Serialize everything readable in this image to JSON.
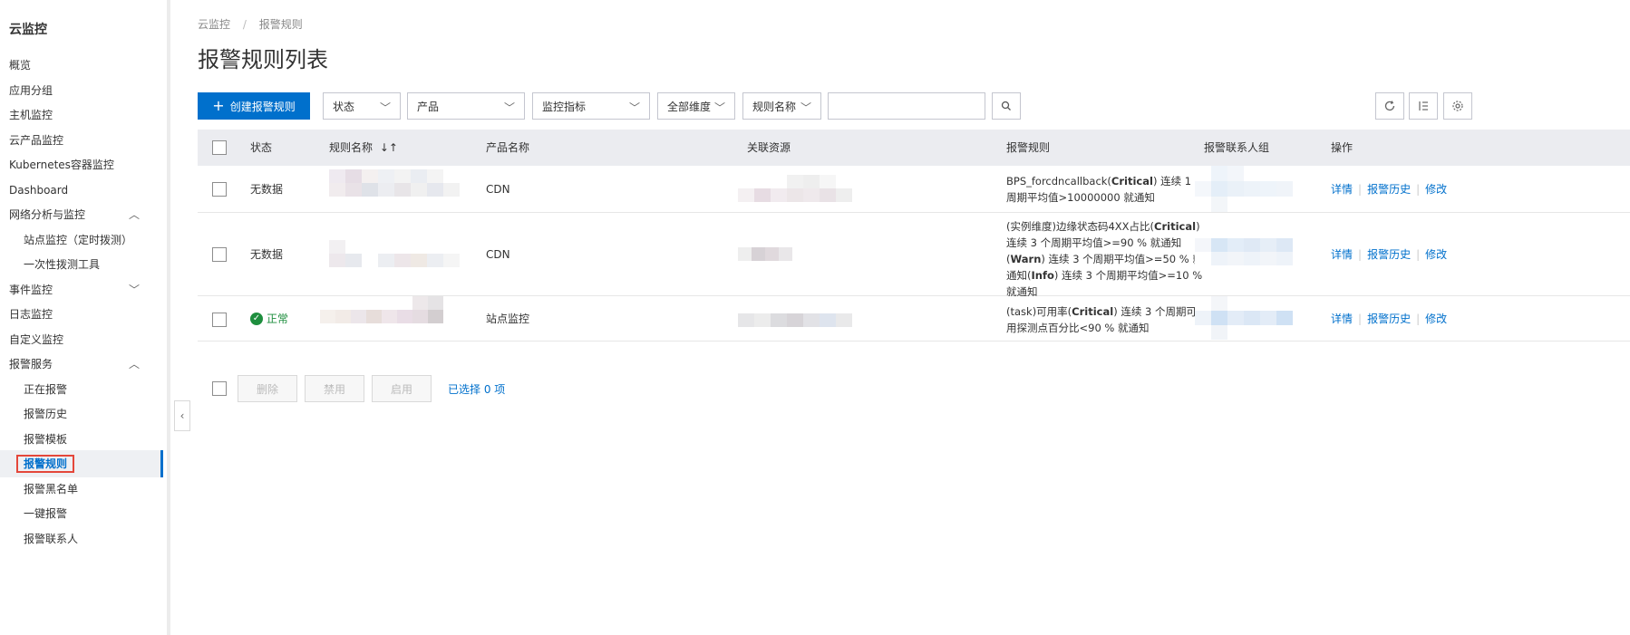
{
  "sidebar": {
    "title": "云监控",
    "items": [
      {
        "label": "概览"
      },
      {
        "label": "应用分组"
      },
      {
        "label": "主机监控"
      },
      {
        "label": "云产品监控"
      },
      {
        "label": "Kubernetes容器监控"
      },
      {
        "label": "Dashboard"
      },
      {
        "label": "网络分析与监控",
        "chevron": "chevron-up-icon"
      },
      {
        "label": "站点监控（定时拨测）"
      },
      {
        "label": "一次性拨测工具"
      },
      {
        "label": "事件监控",
        "chevron": "chevron-down-icon"
      },
      {
        "label": "日志监控"
      },
      {
        "label": "自定义监控"
      },
      {
        "label": "报警服务",
        "chevron": "chevron-up-icon"
      },
      {
        "label": "正在报警"
      },
      {
        "label": "报警历史"
      },
      {
        "label": "报警模板"
      },
      {
        "label": "报警规则",
        "active": true
      },
      {
        "label": "报警黑名单"
      },
      {
        "label": "一键报警"
      },
      {
        "label": "报警联系人"
      }
    ]
  },
  "breadcrumb": {
    "root": "云监控",
    "separator": "/",
    "current": "报警规则"
  },
  "page_title": "报警规则列表",
  "toolbar": {
    "create_label": "创建报警规则",
    "filters": [
      "状态",
      "产品",
      "监控指标",
      "全部维度",
      "规则名称"
    ],
    "search_value": "",
    "icons": [
      "search-icon",
      "refresh-icon",
      "column-settings-icon",
      "gear-icon"
    ]
  },
  "table": {
    "headers": {
      "status": "状态",
      "rule_name": "规则名称",
      "product": "产品名称",
      "resource": "关联资源",
      "alarm_rule": "报警规则",
      "contact_group": "报警联系人组",
      "ops": "操作"
    },
    "rows": [
      {
        "status": "无数据",
        "product": "CDN",
        "rule_html": "BPS_forcdncallback(<b>Critical</b>) 连续 1 个周期平均值>10000000 就通知"
      },
      {
        "status": "无数据",
        "product": "CDN",
        "rule_html": "(实例维度)边缘状态码4XX占比(<b>Critical</b>) 连续 3 个周期平均值>=90 % 就通知 (<b>Warn</b>) 连续 3 个周期平均值>=50 % 就通知(<b>Info</b>) 连续 3 个周期平均值>=10 % 就通知"
      },
      {
        "status": "正常",
        "status_ok": true,
        "product": "站点监控",
        "rule_html": "(task)可用率(<b>Critical</b>) 连续 3 个周期可用探测点百分比<90 % 就通知"
      }
    ],
    "ops": {
      "detail": "详情",
      "history": "报警历史",
      "edit": "修改"
    }
  },
  "footer": {
    "delete": "删除",
    "disable": "禁用",
    "enable": "启用",
    "selected": "已选择 0 项"
  },
  "colors": {
    "primary": "#0070cc",
    "success": "#1e8e3e",
    "highlight": "#e4473a"
  }
}
